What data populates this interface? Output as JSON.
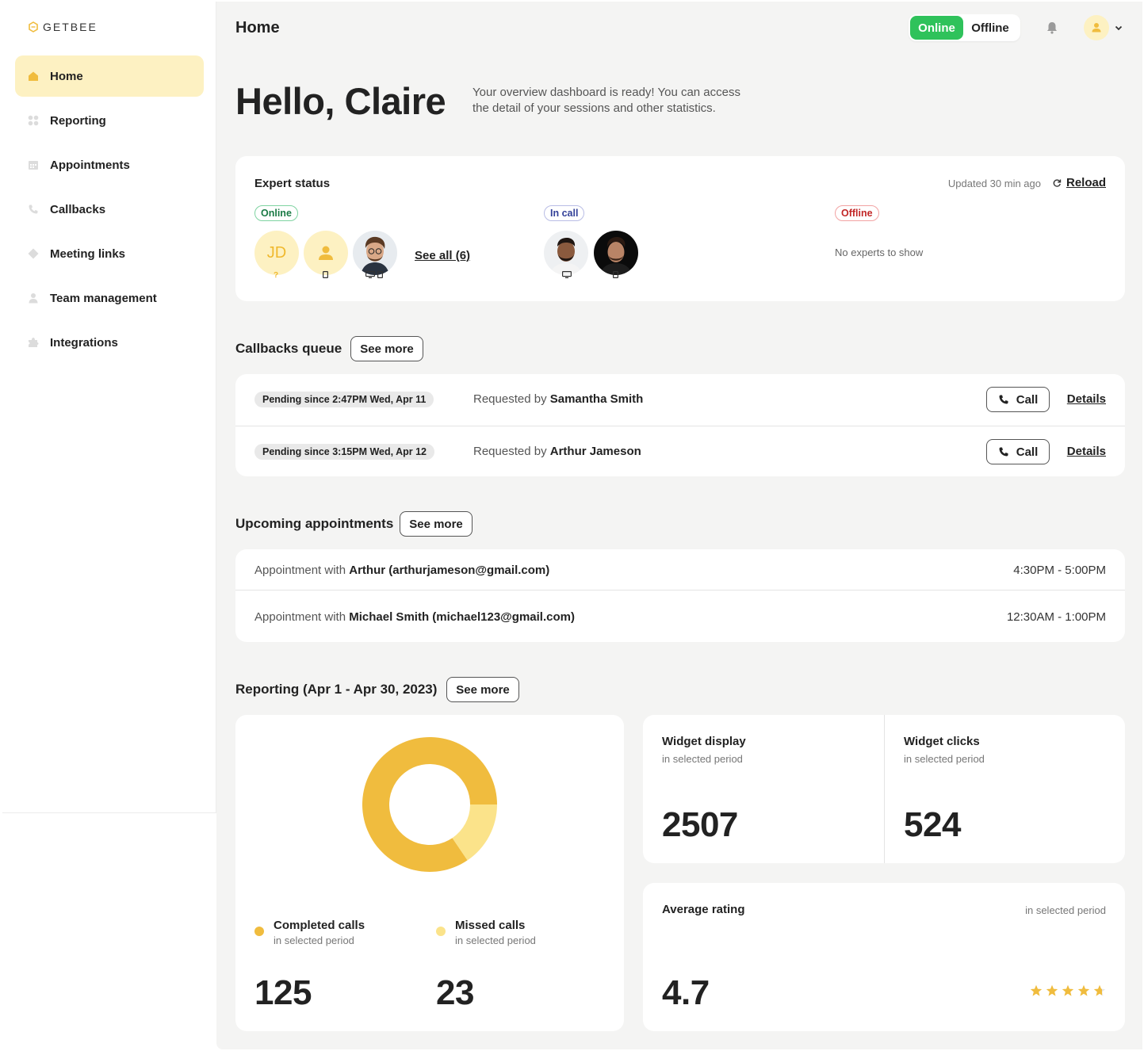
{
  "brand": {
    "name": "GETBEE"
  },
  "sidebar": {
    "items": [
      {
        "label": "Home",
        "icon": "home-icon",
        "active": true
      },
      {
        "label": "Reporting",
        "icon": "reporting-icon",
        "active": false
      },
      {
        "label": "Appointments",
        "icon": "calendar-icon",
        "active": false
      },
      {
        "label": "Callbacks",
        "icon": "phone-icon",
        "active": false
      },
      {
        "label": "Meeting links",
        "icon": "diamond-icon",
        "active": false
      },
      {
        "label": "Team management",
        "icon": "user-icon",
        "active": false
      },
      {
        "label": "Integrations",
        "icon": "puzzle-icon",
        "active": false
      }
    ]
  },
  "header": {
    "title": "Home",
    "status_toggle": {
      "online": "Online",
      "offline": "Offline",
      "selected": "Online"
    }
  },
  "greeting": {
    "title": "Hello, Claire",
    "subtitle": "Your overview dashboard is ready! You can access the detail of your sessions and other statistics."
  },
  "expert_status": {
    "title": "Expert status",
    "updated": "Updated 30 min ago",
    "reload": "Reload",
    "online": {
      "label": "Online",
      "initials": "JD",
      "unknown_device": "?",
      "see_all": "See all (6)"
    },
    "in_call": {
      "label": "In call"
    },
    "offline": {
      "label": "Offline",
      "empty": "No experts to show"
    }
  },
  "callbacks": {
    "title": "Callbacks queue",
    "see_more": "See more",
    "requested_by_prefix": "Requested by",
    "call_label": "Call",
    "details_label": "Details",
    "rows": [
      {
        "pending": "Pending since 2:47PM Wed, Apr 11",
        "requester": "Samantha Smith"
      },
      {
        "pending": "Pending since 3:15PM Wed, Apr 12",
        "requester": "Arthur Jameson"
      }
    ]
  },
  "appointments": {
    "title": "Upcoming appointments",
    "see_more": "See more",
    "prefix": "Appointment with",
    "rows": [
      {
        "who": "Arthur (arthurjameson@gmail.com)",
        "time": "4:30PM - 5:00PM"
      },
      {
        "who": "Michael Smith (michael123@gmail.com)",
        "time": "12:30AM - 1:00PM"
      }
    ]
  },
  "reporting": {
    "title": "Reporting (Apr 1 - Apr 30, 2023)",
    "see_more": "See more",
    "period_label": "in selected period",
    "completed": {
      "label": "Completed calls",
      "value": "125",
      "color": "#f0bc3e"
    },
    "missed": {
      "label": "Missed calls",
      "value": "23",
      "color": "#fbe38a"
    },
    "widget_display": {
      "label": "Widget display",
      "value": "2507"
    },
    "widget_clicks": {
      "label": "Widget clicks",
      "value": "524"
    },
    "rating": {
      "label": "Average rating",
      "value": "4.7",
      "max_stars": 5
    }
  },
  "chart_data": {
    "type": "pie",
    "categories": [
      "Completed calls",
      "Missed calls"
    ],
    "values": [
      125,
      23
    ],
    "colors": [
      "#f0bc3e",
      "#fbe38a"
    ],
    "title": ""
  },
  "colors": {
    "accent": "#f0bc3e",
    "online": "#2fc25b",
    "active_nav": "#fdf1c2"
  }
}
